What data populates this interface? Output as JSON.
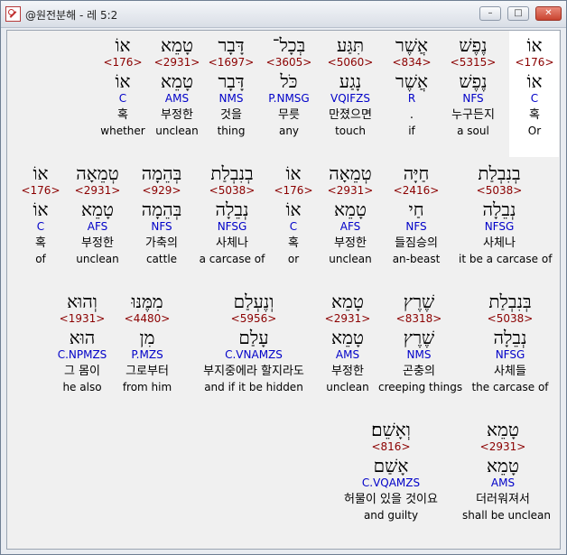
{
  "window": {
    "title": "@원전분해 - 레 5:2",
    "min_label": "–",
    "max_label": "□",
    "close_label": "✕"
  },
  "rows": [
    {
      "words": [
        {
          "heb": "אוֹ",
          "num": "<176>",
          "lemma": "אוֹ",
          "parse": "C",
          "kor": "혹",
          "eng": "Or"
        },
        {
          "heb": "נֶפֶשׁ",
          "num": "<5315>",
          "lemma": "נֶפֶשׁ",
          "parse": "NFS",
          "kor": "누구든지",
          "eng": "a soul"
        },
        {
          "heb": "אֲשֶׁר",
          "num": "<834>",
          "lemma": "אֲשֶׁר",
          "parse": "R",
          "kor": ".",
          "eng": "if"
        },
        {
          "heb": "תִּגַּע",
          "num": "<5060>",
          "lemma": "נָגַע",
          "parse": "VQIFZS",
          "kor": "만졌으면",
          "eng": "touch"
        },
        {
          "heb": "בְּכָל־",
          "num": "<3605>",
          "lemma": "כֹּל",
          "parse": "P.NMSG",
          "kor": "무릇",
          "eng": "any"
        },
        {
          "heb": "דָּבָר",
          "num": "<1697>",
          "lemma": "דָּבָר",
          "parse": "NMS",
          "kor": "것을",
          "eng": "thing"
        },
        {
          "heb": "טָמֵא",
          "num": "<2931>",
          "lemma": "טָמֵא",
          "parse": "AMS",
          "kor": "부정한",
          "eng": "unclean"
        },
        {
          "heb": "אוֹ",
          "num": "<176>",
          "lemma": "אוֹ",
          "parse": "C",
          "kor": "혹",
          "eng": "whether"
        }
      ]
    },
    {
      "words": [
        {
          "heb": "בְנִבְלַת",
          "num": "<5038>",
          "lemma": "נְבֵלָה",
          "parse": "NFSG",
          "kor": "사체나",
          "eng": "it be a carcase of"
        },
        {
          "heb": "חַיָּה",
          "num": "<2416>",
          "lemma": "חַי",
          "parse": "NFS",
          "kor": "들짐승의",
          "eng": "an-beast"
        },
        {
          "heb": "טְמֵאָה",
          "num": "<2931>",
          "lemma": "טָמֵא",
          "parse": "AFS",
          "kor": "부정한",
          "eng": "unclean"
        },
        {
          "heb": "אוֹ",
          "num": "<176>",
          "lemma": "אוֹ",
          "parse": "C",
          "kor": "혹",
          "eng": "or"
        },
        {
          "heb": "בְנִבְלַת",
          "num": "<5038>",
          "lemma": "נְבֵלָה",
          "parse": "NFSG",
          "kor": "사체나",
          "eng": "a carcase of"
        },
        {
          "heb": "בְּהֵמָה",
          "num": "<929>",
          "lemma": "בְּהֵמָה",
          "parse": "NFS",
          "kor": "가축의",
          "eng": "cattle"
        },
        {
          "heb": "טְמֵאָה",
          "num": "<2931>",
          "lemma": "טָמֵא",
          "parse": "AFS",
          "kor": "부정한",
          "eng": "unclean"
        },
        {
          "heb": "אוֹ",
          "num": "<176>",
          "lemma": "אוֹ",
          "parse": "C",
          "kor": "혹",
          "eng": "of"
        }
      ]
    },
    {
      "words": [
        {
          "heb": "בְּנִבְלַת",
          "num": "<5038>",
          "lemma": "נְבֵלָה",
          "parse": "NFSG",
          "kor": "사체들",
          "eng": "the carcase of"
        },
        {
          "heb": "שֶׁרֶץ",
          "num": "<8318>",
          "lemma": "שֶׁרֶץ",
          "parse": "NMS",
          "kor": "곤충의",
          "eng": "creeping things"
        },
        {
          "heb": "טָמֵא",
          "num": "<2931>",
          "lemma": "טָמֵא",
          "parse": "AMS",
          "kor": "부정한",
          "eng": "unclean"
        },
        {
          "heb": "וְנֶעְלַם",
          "num": "<5956>",
          "lemma": "עָלַם",
          "parse": "C.VNAMZS",
          "kor": "부지중에라 할지라도",
          "eng": "and if it be hidden"
        },
        {
          "heb": "מִמֶּנּוּ",
          "num": "<4480>",
          "lemma": "מִן",
          "parse": "P.MZS",
          "kor": "그로부터",
          "eng": "from him"
        },
        {
          "heb": "וְהוּא",
          "num": "<1931>",
          "lemma": "הוּא",
          "parse": "C.NPMZS",
          "kor": "그 몸이",
          "eng": "he also"
        }
      ]
    },
    {
      "words": [
        {
          "heb": "טָמֵא",
          "num": "<2931>",
          "lemma": "טָמֵא",
          "parse": "AMS",
          "kor": "더러워져서",
          "eng": "shall be unclean"
        },
        {
          "heb": "וְאָשֵׁם׃",
          "num": "<816>",
          "lemma": "אָשַׁם",
          "parse": "C.VQAMZS",
          "kor": "허물이 있을 것이요",
          "eng": "and guilty"
        }
      ]
    }
  ]
}
